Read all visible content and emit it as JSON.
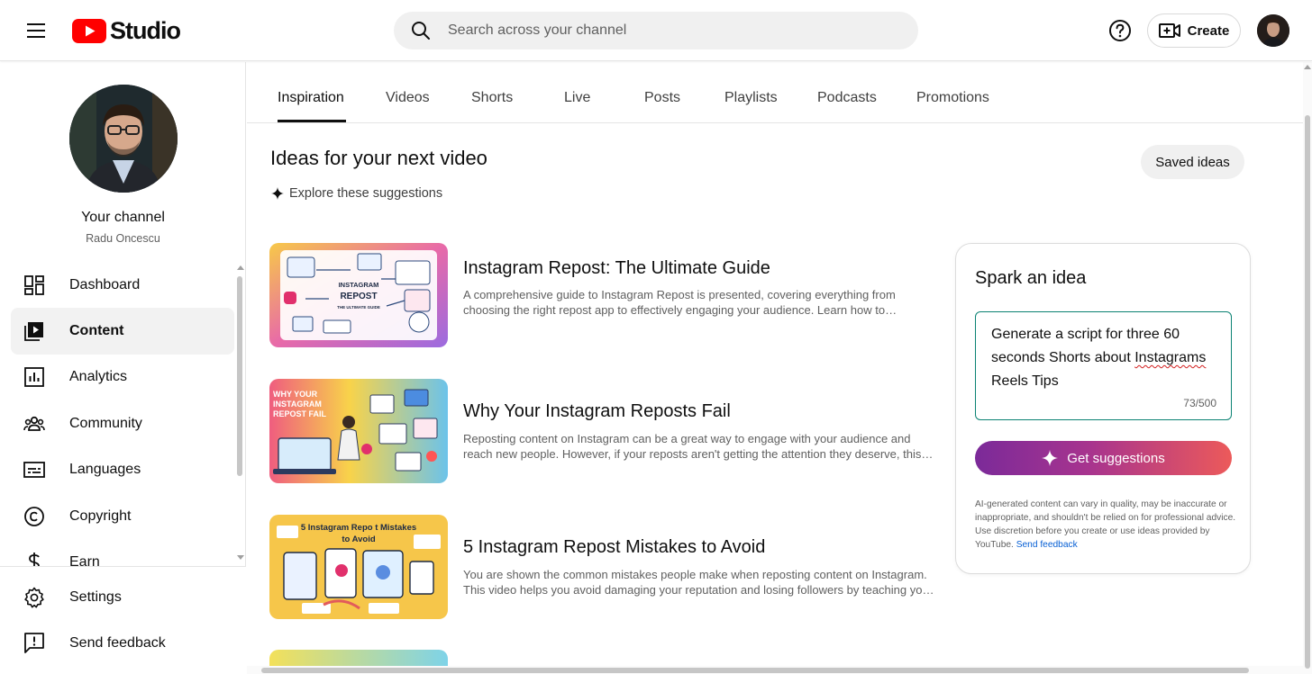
{
  "header": {
    "logo_text": "Studio",
    "search_placeholder": "Search across your channel",
    "create_label": "Create"
  },
  "sidebar": {
    "channel_title": "Your channel",
    "channel_handle": "Radu Oncescu",
    "items": [
      {
        "label": "Dashboard",
        "icon": "dashboard-icon"
      },
      {
        "label": "Content",
        "icon": "content-icon",
        "active": true
      },
      {
        "label": "Analytics",
        "icon": "analytics-icon"
      },
      {
        "label": "Community",
        "icon": "community-icon"
      },
      {
        "label": "Languages",
        "icon": "languages-icon"
      },
      {
        "label": "Copyright",
        "icon": "copyright-icon"
      },
      {
        "label": "Earn",
        "icon": "earn-icon"
      }
    ],
    "bottom_items": [
      {
        "label": "Settings",
        "icon": "settings-icon"
      },
      {
        "label": "Send feedback",
        "icon": "feedback-icon"
      }
    ]
  },
  "tabs": [
    "Inspiration",
    "Videos",
    "Shorts",
    "Live",
    "Posts",
    "Playlists",
    "Podcasts",
    "Promotions"
  ],
  "active_tab": "Inspiration",
  "main": {
    "title": "Ideas for your next video",
    "subtitle": "Explore these suggestions",
    "saved_ideas_label": "Saved ideas"
  },
  "ideas": [
    {
      "title": "Instagram Repost: The Ultimate Guide",
      "description": "A comprehensive guide to Instagram Repost is presented, covering everything from choosing the right repost app to effectively engaging your audience. Learn how to…",
      "thumb_lines": [
        "INSTAGRAM",
        "REPOST",
        "THE ULTIMATE GUIDE"
      ]
    },
    {
      "title": "Why Your Instagram Reposts Fail",
      "description": "Reposting content on Instagram can be a great way to engage with your audience and reach new people. However, if your reposts aren't getting the attention they deserve, this…",
      "thumb_lines": [
        "WHY YOUR",
        "INSTAGRAM",
        "REPOST FAIL"
      ]
    },
    {
      "title": "5 Instagram Repost Mistakes to Avoid",
      "description": "You are shown the common mistakes people make when reposting content on Instagram. This video helps you avoid damaging your reputation and losing followers by teaching yo…",
      "thumb_lines": [
        "5 Instagram Repo t Mistakes",
        "to Avoid"
      ]
    }
  ],
  "spark": {
    "title": "Spark an idea",
    "prompt_part1": "Generate a script for three 60 seconds Shorts about ",
    "prompt_misspelled": "Instagrams",
    "prompt_part2": " Reels Tips",
    "char_count": "73/500",
    "button_label": "Get suggestions",
    "disclaimer": "AI-generated content can vary in quality, may be inaccurate or inappropriate, and shouldn't be relied on for professional advice. Use discretion before you create or use ideas provided by YouTube.",
    "feedback_link": "Send feedback"
  },
  "colors": {
    "brand_red": "#ff0000",
    "accent_teal": "#0b8273",
    "link_blue": "#065fd4",
    "gradient_start": "#7b2a99",
    "gradient_end": "#ec5a5a"
  }
}
